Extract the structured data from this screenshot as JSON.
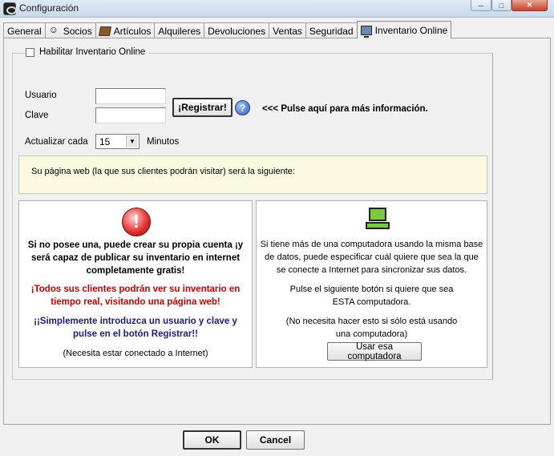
{
  "window": {
    "title": "Configuración",
    "minimize": "─",
    "maximize": "□",
    "close": "✕",
    "app_icon": "app-logo-icon"
  },
  "tabs": [
    {
      "label": "General",
      "icon": ""
    },
    {
      "label": "Socios",
      "icon": "user-icon"
    },
    {
      "label": "Artículos",
      "icon": "book-icon"
    },
    {
      "label": "Alquileres",
      "icon": ""
    },
    {
      "label": "Devoluciones",
      "icon": ""
    },
    {
      "label": "Ventas",
      "icon": ""
    },
    {
      "label": "Seguridad",
      "icon": ""
    },
    {
      "label": "Inventario Online",
      "icon": "monitor-icon",
      "active": true
    }
  ],
  "online": {
    "enable_label": "Habilitar Inventario Online",
    "enabled": false,
    "usuario_label": "Usuario",
    "usuario_value": "",
    "clave_label": "Clave",
    "clave_value": "",
    "registrar_label": "¡Registrar!",
    "help_symbol": "?",
    "pulse_text": "<<< Pulse aquí para más información.",
    "actualizar_label": "Actualizar cada",
    "actualizar_value": "15",
    "minutos_label": "Minutos",
    "web_text": "Su página web (la que sus clientes podrán visitar) será la siguiente:"
  },
  "left_panel": {
    "icon_symbol": "!",
    "p1": "Si no posee una, puede crear su propia cuenta ¡y será capaz de publicar su inventario en internet completamente gratis!",
    "p2": "¡Todos sus clientes podrán ver su inventario en tiempo real, visitando una página web!",
    "p3": "¡¡Simplemente introduzca un usuario y clave y pulse en el botón Registrar!!",
    "p4": "(Necesita estar conectado a Internet)"
  },
  "right_panel": {
    "p1": "Si tiene más de una computadora usando la misma base de datos, puede especificar cuál quiere que sea la que se conecte a Internet para sincronizar sus datos.",
    "p2": "Pulse el siguiente botón si quiere que sea ESTA computadora.",
    "p3": "(No necesita hacer esto si sólo está usando una computadora)",
    "button_label": "Usar esa computadora"
  },
  "footer": {
    "ok_label": "OK",
    "cancel_label": "Cancel"
  }
}
